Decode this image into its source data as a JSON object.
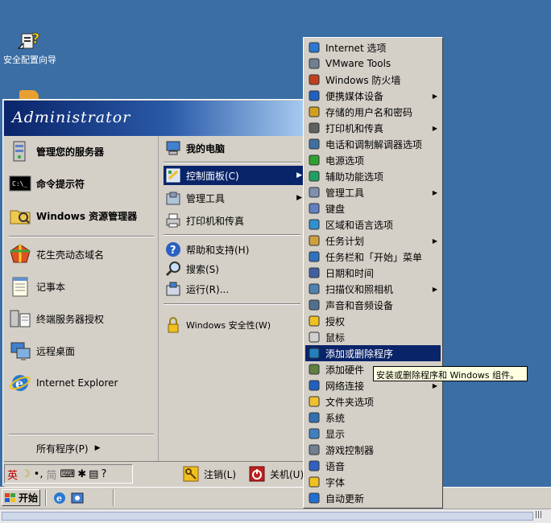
{
  "desktop": {
    "icon_label": "安全配置向导"
  },
  "start_menu": {
    "user": "Administrator",
    "pinned": [
      {
        "label": "管理您的服务器",
        "icon": "server-icon"
      },
      {
        "label": "命令提示符",
        "icon": "cmd-icon"
      },
      {
        "label": "Windows 资源管理器",
        "icon": "explorer-icon"
      }
    ],
    "recent": [
      {
        "label": "花生壳动态域名",
        "icon": "peanut-icon"
      },
      {
        "label": "记事本",
        "icon": "notepad-icon"
      },
      {
        "label": "终端服务器授权",
        "icon": "license-icon"
      },
      {
        "label": "远程桌面",
        "icon": "remote-desktop-icon"
      },
      {
        "label": "Internet Explorer",
        "icon": "ie-icon"
      }
    ],
    "all_programs": "所有程序(P)",
    "right": {
      "my_computer": "我的电脑",
      "control_panel": "控制面板(C)",
      "admin_tools": "管理工具",
      "printers": "打印机和传真",
      "help": "帮助和支持(H)",
      "search": "搜索(S)",
      "run": "运行(R)...",
      "security": "Windows 安全性(W)"
    },
    "logoff": "注销(L)",
    "shutdown": "关机(U)"
  },
  "language_bar": {
    "lang": "英",
    "mode": "简"
  },
  "taskbar": {
    "start": "开始"
  },
  "control_panel_menu": [
    {
      "label": "Internet 选项",
      "arrow": false
    },
    {
      "label": "VMware Tools",
      "arrow": false
    },
    {
      "label": "Windows 防火墙",
      "arrow": false
    },
    {
      "label": "便携媒体设备",
      "arrow": true
    },
    {
      "label": "存储的用户名和密码",
      "arrow": false
    },
    {
      "label": "打印机和传真",
      "arrow": true
    },
    {
      "label": "电话和调制解调器选项",
      "arrow": false
    },
    {
      "label": "电源选项",
      "arrow": false
    },
    {
      "label": "辅助功能选项",
      "arrow": false
    },
    {
      "label": "管理工具",
      "arrow": true
    },
    {
      "label": "键盘",
      "arrow": false
    },
    {
      "label": "区域和语言选项",
      "arrow": false
    },
    {
      "label": "任务计划",
      "arrow": true
    },
    {
      "label": "任务栏和「开始」菜单",
      "arrow": false
    },
    {
      "label": "日期和时间",
      "arrow": false
    },
    {
      "label": "扫描仪和照相机",
      "arrow": true
    },
    {
      "label": "声音和音频设备",
      "arrow": false
    },
    {
      "label": "授权",
      "arrow": false
    },
    {
      "label": "鼠标",
      "arrow": false
    },
    {
      "label": "添加或删除程序",
      "arrow": false
    },
    {
      "label": "添加硬件",
      "arrow": false
    },
    {
      "label": "网络连接",
      "arrow": true
    },
    {
      "label": "文件夹选项",
      "arrow": false
    },
    {
      "label": "系统",
      "arrow": false
    },
    {
      "label": "显示",
      "arrow": false
    },
    {
      "label": "游戏控制器",
      "arrow": false
    },
    {
      "label": "语音",
      "arrow": false
    },
    {
      "label": "字体",
      "arrow": false
    },
    {
      "label": "自动更新",
      "arrow": false
    }
  ],
  "tooltip": "安装或删除程序和 Windows 组件。",
  "colors": {
    "desktop": "#3a6ea5",
    "menu": "#d4d0c8",
    "selection": "#0a246a",
    "tooltip": "#ffffe1"
  }
}
